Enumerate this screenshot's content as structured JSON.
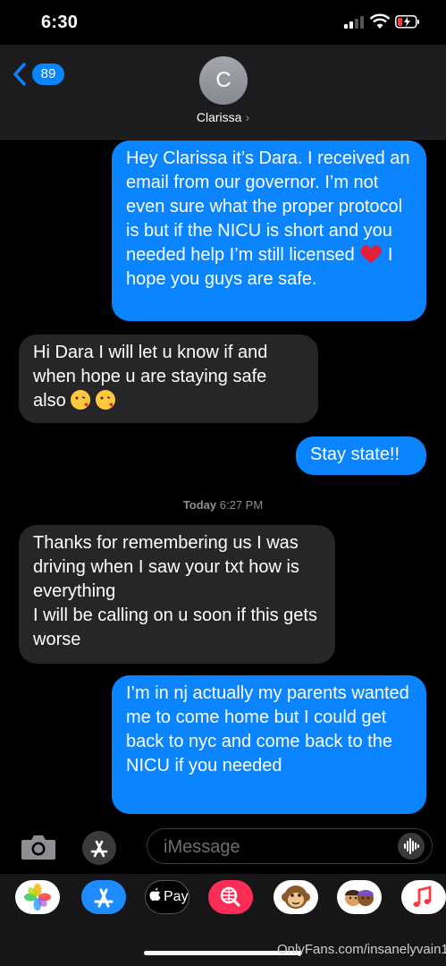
{
  "status": {
    "time": "6:30"
  },
  "nav": {
    "unread_count": "89",
    "avatar_initial": "C",
    "contact_name": "Clarissa",
    "chevron": "›"
  },
  "messages": [
    {
      "dir": "out",
      "text": "Hey Clarissa it’s Dara. I received an email from our governor. I’m not even sure what the proper protocol is but if the NICU is short and you needed help I’m still licensed",
      "trail": " I hope you guys are safe."
    },
    {
      "dir": "in",
      "text": "Hi Dara I will let u know if and when hope u are staying safe also"
    },
    {
      "dir": "out",
      "text": "Stay state!!"
    },
    {
      "dir": "in",
      "text": "Thanks for remembering us I was driving when I saw your txt how is everything\nI will be calling on u soon if this gets worse"
    },
    {
      "dir": "out",
      "text": "I’m in nj actually my parents wanted me to come home but I could get back to nyc and come back to the NICU if you needed"
    }
  ],
  "timestamp": {
    "day": "Today",
    "time": "6:27 PM"
  },
  "input": {
    "placeholder": "iMessage"
  },
  "app_strip": [
    {
      "name": "Photos",
      "icon": "photos-icon"
    },
    {
      "name": "App Store",
      "icon": "app-store-icon"
    },
    {
      "name": "Apple Pay",
      "label": "Pay",
      "icon": "apple-pay-icon"
    },
    {
      "name": "Search",
      "icon": "web-search-icon"
    },
    {
      "name": "Animoji",
      "icon": "monkey-animoji-icon"
    },
    {
      "name": "Memoji",
      "icon": "memoji-icon"
    },
    {
      "name": "Music",
      "icon": "music-icon"
    }
  ],
  "watermark": "OnlyFans.com/insanelyvain1",
  "colors": {
    "outgoing": "#0a84ff",
    "incoming": "#262628",
    "background": "#000000"
  }
}
